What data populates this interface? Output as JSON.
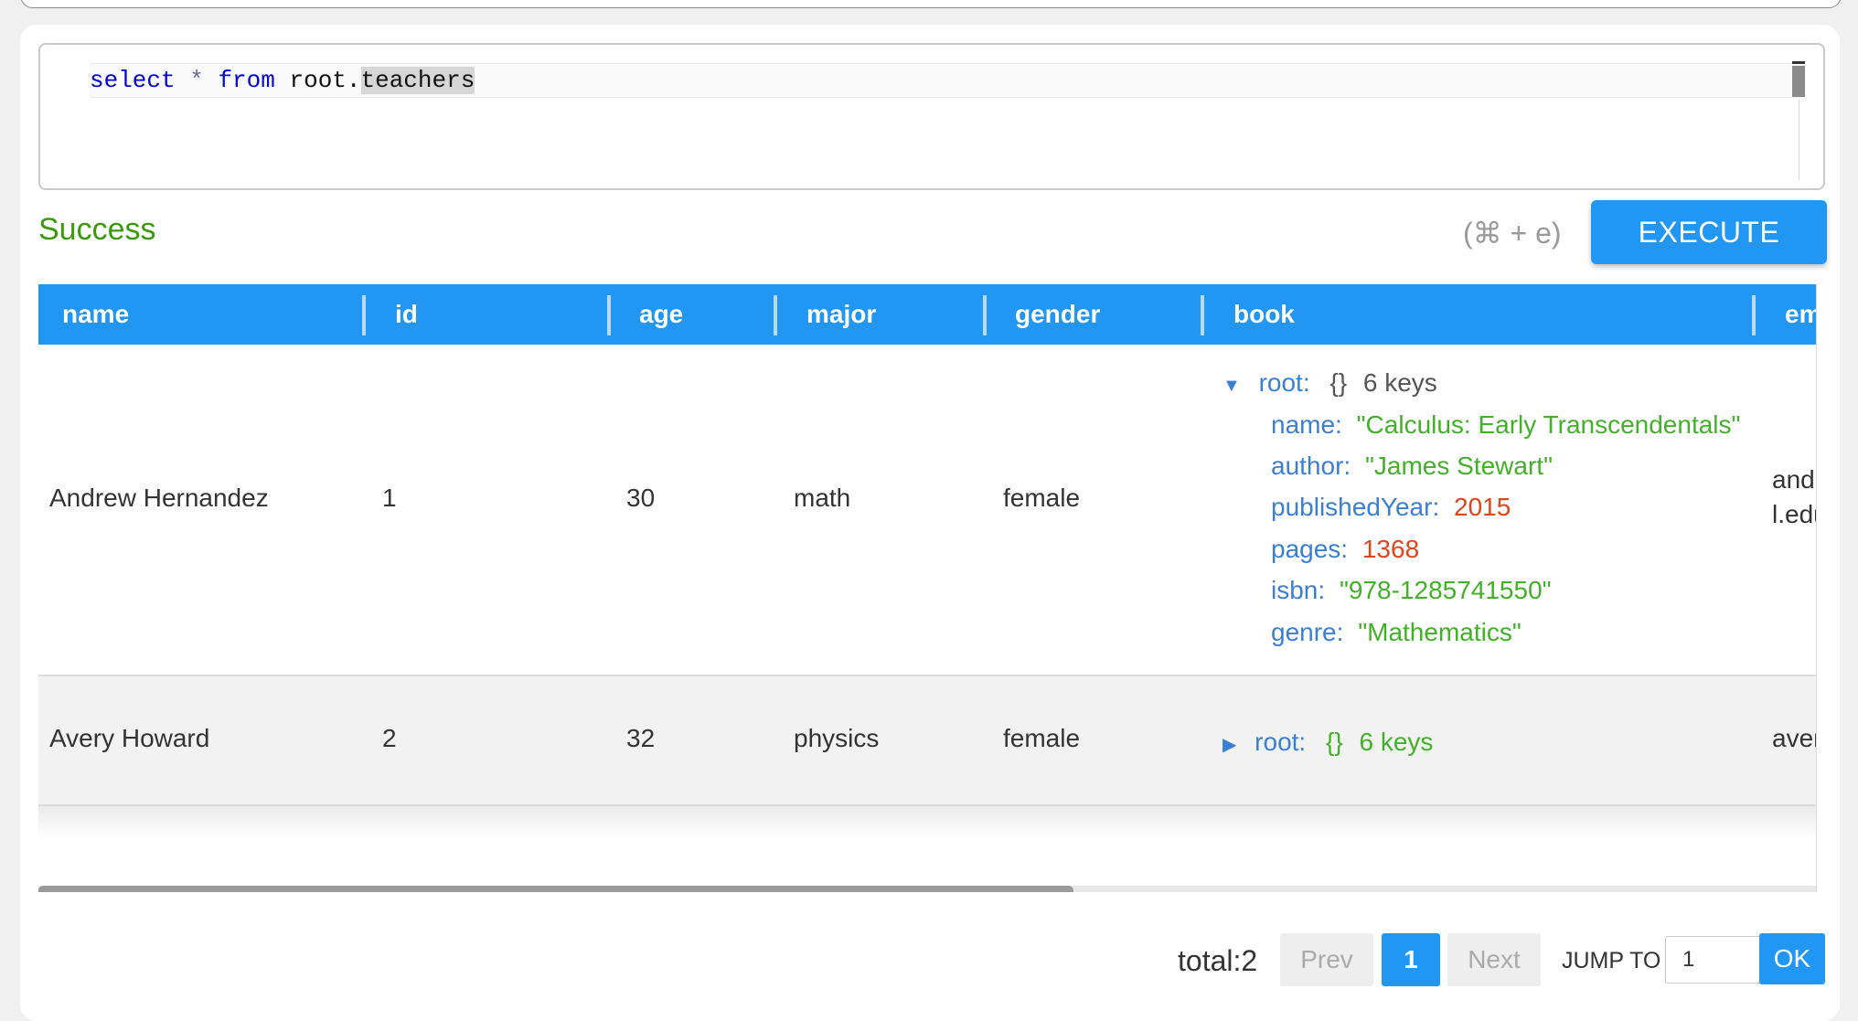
{
  "editor": {
    "query": {
      "kw_select": "select",
      "star": "*",
      "kw_from": "from",
      "prefix": "root.",
      "selected": "teachers"
    }
  },
  "status": {
    "text": "Success",
    "color": "#3a9a0c"
  },
  "toolbar": {
    "shortcut": "(⌘ + e)",
    "execute_label": "EXECUTE"
  },
  "table": {
    "columns": [
      "name",
      "id",
      "age",
      "major",
      "gender",
      "book",
      "em"
    ],
    "rows": [
      {
        "name": "Andrew Hernandez",
        "id": "1",
        "age": "30",
        "major": "math",
        "gender": "female",
        "book": {
          "expanded": true,
          "root_label": "root:",
          "braces": "{}",
          "count": "6 keys",
          "fields": [
            {
              "key": "name:",
              "value": "\"Calculus: Early Transcendentals\"",
              "type": "string"
            },
            {
              "key": "author:",
              "value": "\"James Stewart\"",
              "type": "string"
            },
            {
              "key": "publishedYear:",
              "value": "2015",
              "type": "number"
            },
            {
              "key": "pages:",
              "value": "1368",
              "type": "number"
            },
            {
              "key": "isbn:",
              "value": "\"978-1285741550\"",
              "type": "string"
            },
            {
              "key": "genre:",
              "value": "\"Mathematics\"",
              "type": "string"
            }
          ]
        },
        "email_line1": "and",
        "email_line2": "l.edu"
      },
      {
        "name": "Avery Howard",
        "id": "2",
        "age": "32",
        "major": "physics",
        "gender": "female",
        "book": {
          "expanded": false,
          "root_label": "root:",
          "braces": "{}",
          "count": "6 keys"
        },
        "email_line1": "aver"
      }
    ]
  },
  "pagination": {
    "total": "total:2",
    "prev": "Prev",
    "current": "1",
    "next": "Next",
    "jump_label": "JUMP TO",
    "jump_value": "1",
    "ok": "OK"
  },
  "colors": {
    "accent": "#2196f3",
    "json_key": "#3a7fd6",
    "json_string": "#43b02a",
    "json_number": "#e0441a"
  }
}
